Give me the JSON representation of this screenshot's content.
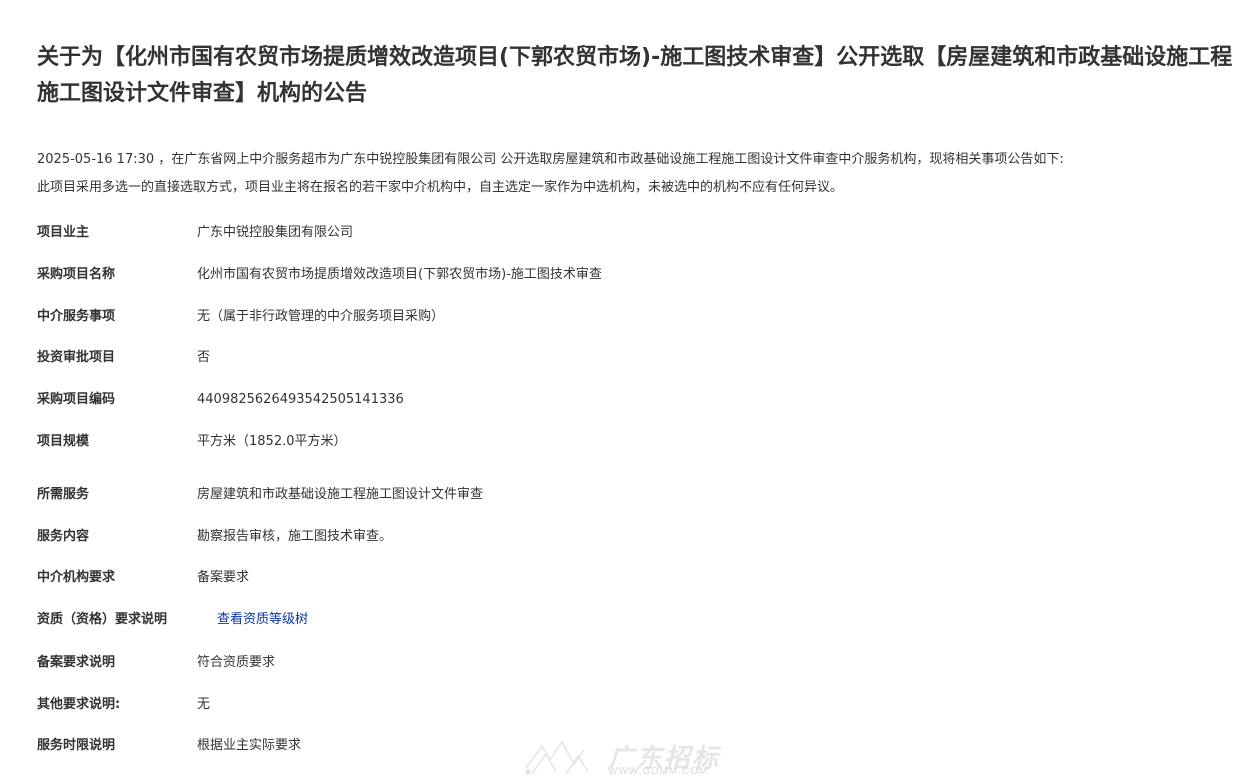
{
  "notice": {
    "title": "关于为【化州市国有农贸市场提质增效改造项目(下郭农贸市场)-施工图技术审查】公开选取【房屋建筑和市政基础设施工程施工图设计文件审查】机构的公告",
    "intro_line1": "2025-05-16 17:30 ，在广东省网上中介服务超市为广东中锐控股集团有限公司 公开选取房屋建筑和市政基础设施工程施工图设计文件审查中介服务机构，现将相关事项公告如下:",
    "intro_line2": "此项目采用多选一的直接选取方式，项目业主将在报名的若干家中介机构中，自主选定一家作为中选机构，未被选中的机构不应有任何异议。"
  },
  "fields": [
    {
      "label": "项目业主",
      "value": "广东中锐控股集团有限公司"
    },
    {
      "label": "采购项目名称",
      "value": "化州市国有农贸市场提质增效改造项目(下郭农贸市场)-施工图技术审查"
    },
    {
      "label": "中介服务事项",
      "value": "无（属于非行政管理的中介服务项目采购）"
    },
    {
      "label": "投资审批项目",
      "value": "否"
    },
    {
      "label": "采购项目编码",
      "value": "44098256264935425051413​36"
    },
    {
      "label": "项目规模",
      "value": "平方米（1852.0平方米）"
    },
    {
      "label": "所需服务",
      "value": "房屋建筑和市政基础设施工程施工图设计文件审查"
    },
    {
      "label": "服务内容",
      "value": "勘察报告审核，施工图技术审查。"
    },
    {
      "label": "中介机构要求",
      "value": "备案要求"
    },
    {
      "label": "资质（资格）要求说明",
      "value": "查看资质等级树"
    },
    {
      "label": "备案要求说明",
      "value": "符合资质要求"
    },
    {
      "label": "其他要求说明:",
      "value": "无"
    },
    {
      "label": "服务时限说明",
      "value": "根据业主实际要求"
    }
  ],
  "watermark": {
    "text": "广东招标",
    "sub": "WWW.GDMM.COM"
  },
  "colors": {
    "text": "#333333",
    "link": "#0b36a8",
    "background": "#ffffff"
  }
}
